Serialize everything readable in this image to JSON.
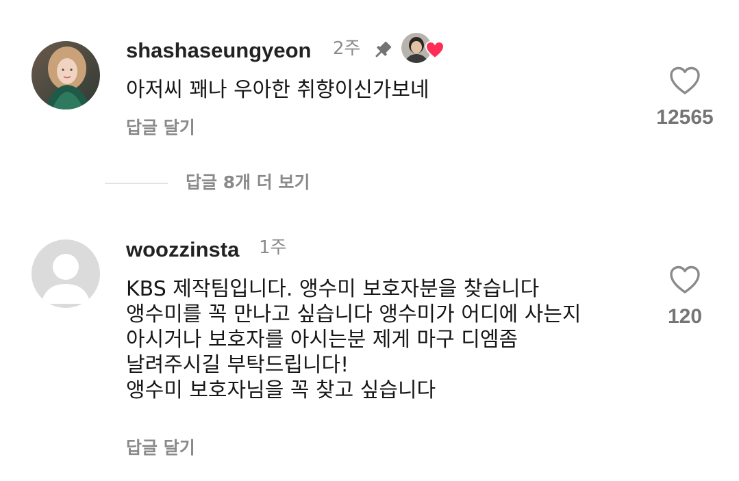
{
  "comments": [
    {
      "username": "shashaseungyeon",
      "time": "2주",
      "pinned": true,
      "creator_liked": true,
      "lines": [
        "아저씨 꽤나 우아한 취향이신가보네"
      ],
      "reply_label": "답글 달기",
      "like_count": "12565",
      "icons": [
        "pin-icon",
        "creator-avatar",
        "heart-badge-icon",
        "heart-outline-icon"
      ]
    },
    {
      "username": "woozzinsta",
      "time": "1주",
      "lines": [
        "KBS 제작팀입니다. 앵수미 보호자분을 찾습니다",
        "앵수미를 꼭 만나고 싶습니다 앵수미가 어디에 사는지",
        "아시거나 보호자를 아시는분 제게 마구 디엠좀",
        "날려주시길 부탁드립니다!",
        "앵수미 보호자님을 꼭 찾고 싶습니다"
      ],
      "reply_label": "답글 달기",
      "like_count": "120",
      "icons": [
        "default-avatar-icon",
        "heart-outline-icon"
      ]
    }
  ],
  "view_replies": {
    "label": "답글 8개 더 보기"
  },
  "colors": {
    "text": "#161616",
    "muted": "#8a8a8a",
    "heart_badge": "#ff2d55",
    "heart_outline": "#8a8a8a"
  }
}
